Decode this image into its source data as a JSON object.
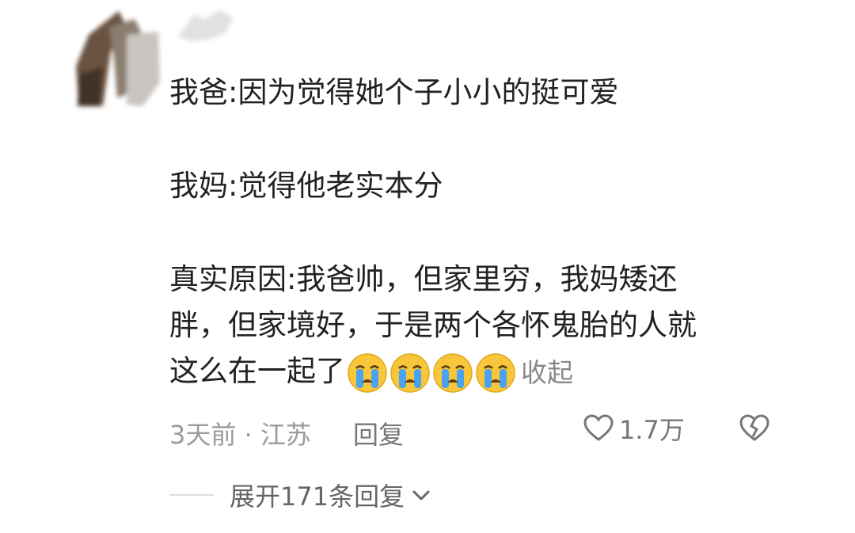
{
  "comment": {
    "paragraphs": {
      "p1": "我爸:因为觉得她个子小小的挺可爱",
      "p2": "我妈:觉得他老实本分",
      "p3_line1": "真实原因:我爸帅，但家里穷，我妈矮还",
      "p3_line2": "胖，但家境好，于是两个各怀鬼胎的人就",
      "p3_line3": "这么在一起了"
    },
    "emojis": [
      "crying-face-emoji",
      "crying-face-emoji",
      "crying-face-emoji",
      "crying-face-emoji"
    ],
    "collapse_label": "收起"
  },
  "meta": {
    "time_location": "3天前 · 江苏",
    "reply_label": "回复",
    "like_count": "1.7万"
  },
  "expand": {
    "label": "展开171条回复"
  },
  "colors": {
    "text": "#222222",
    "muted": "#9a9a9a",
    "emoji_face": "#f7c63a",
    "emoji_tear": "#4aa3f0"
  }
}
